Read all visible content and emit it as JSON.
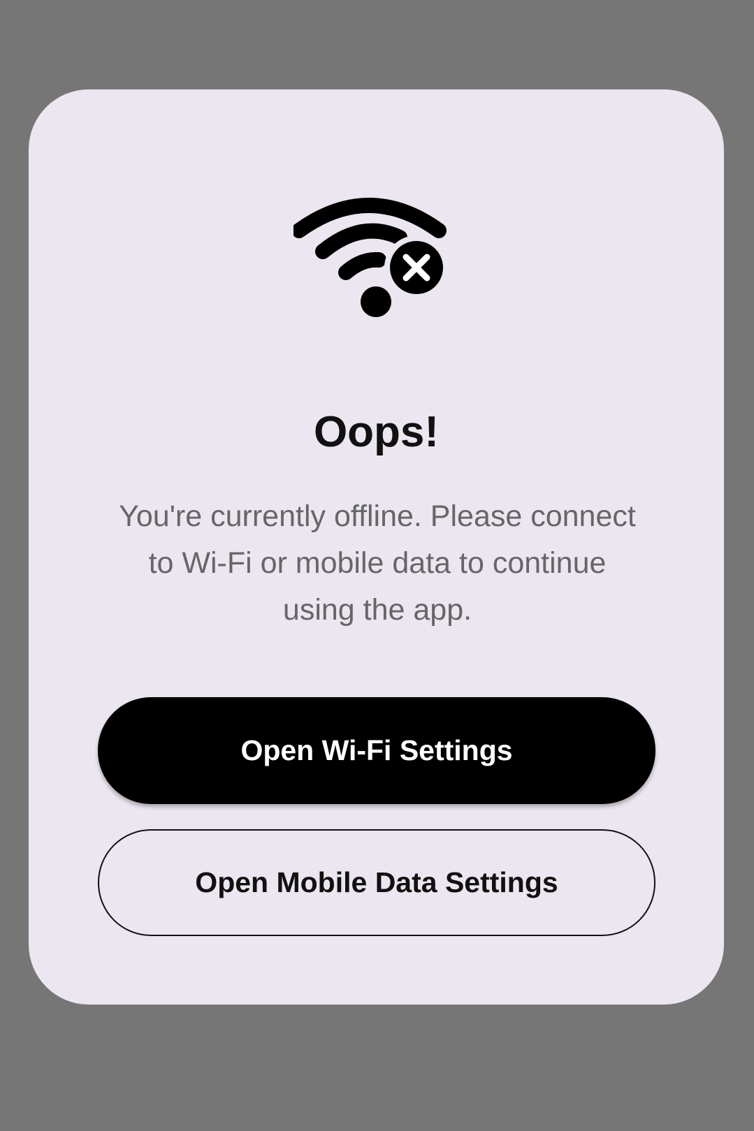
{
  "dialog": {
    "icon": "wifi-off-icon",
    "title": "Oops!",
    "message": "You're currently offline. Please connect to Wi-Fi or mobile data to continue using the app.",
    "primary_button": "Open Wi-Fi Settings",
    "secondary_button": "Open Mobile Data Settings"
  },
  "colors": {
    "backdrop": "#767676",
    "dialog_background": "#ebe6f0",
    "primary_button_bg": "#000000",
    "primary_button_text": "#ffffff",
    "message_text": "#666666"
  }
}
